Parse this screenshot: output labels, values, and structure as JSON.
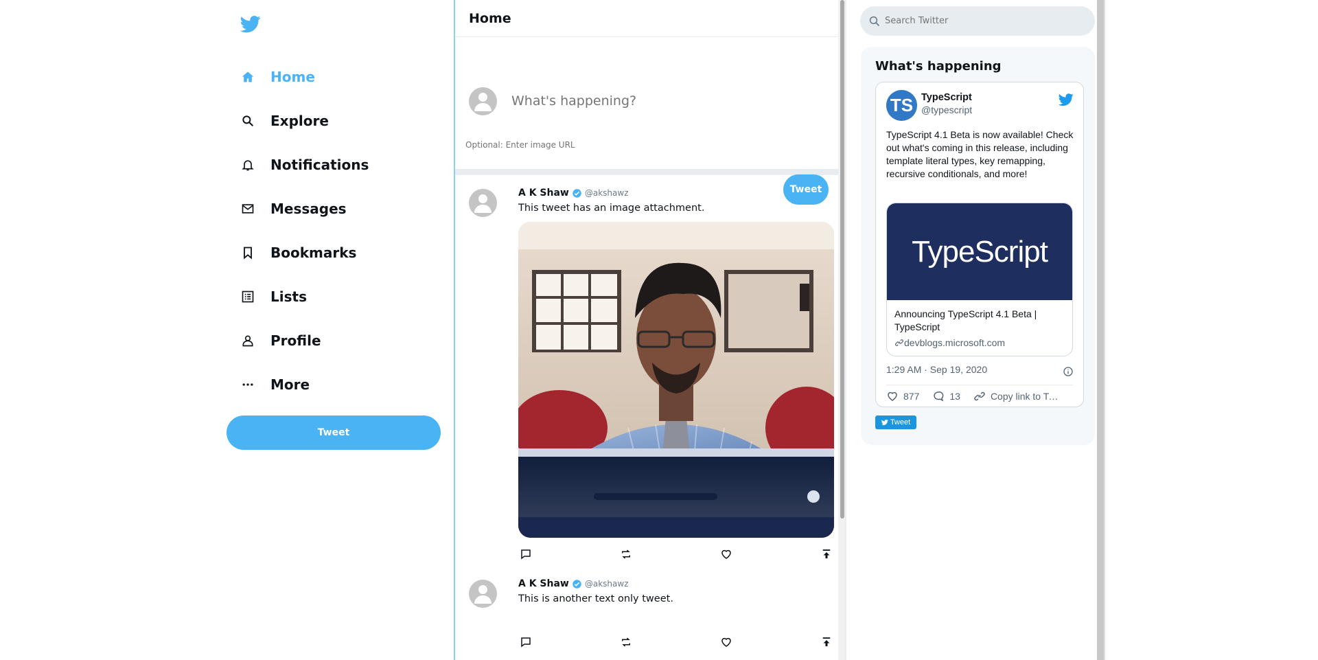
{
  "colors": {
    "accent": "#4ab3f4",
    "feed_border": "#8ecdf5",
    "typescript_blue": "#3178c6",
    "card_navy": "#1e2e5f"
  },
  "sidebar": {
    "logo_icon": "twitter-bird-icon",
    "items": [
      {
        "label": "Home",
        "icon": "home-icon",
        "active": true
      },
      {
        "label": "Explore",
        "icon": "search-icon"
      },
      {
        "label": "Notifications",
        "icon": "bell-icon"
      },
      {
        "label": "Messages",
        "icon": "mail-icon"
      },
      {
        "label": "Bookmarks",
        "icon": "bookmark-icon"
      },
      {
        "label": "Lists",
        "icon": "list-icon"
      },
      {
        "label": "Profile",
        "icon": "person-icon"
      },
      {
        "label": "More",
        "icon": "more-icon"
      }
    ],
    "tweet_button": "Tweet"
  },
  "feed": {
    "title": "Home",
    "composer": {
      "placeholder": "What's happening?",
      "image_placeholder": "Optional: Enter image URL",
      "tweet_button": "Tweet"
    },
    "tweets": [
      {
        "name": "A K Shaw",
        "handle": "@akshawz",
        "verified": true,
        "text": "This tweet has an image attachment.",
        "has_image": true
      },
      {
        "name": "A K Shaw",
        "handle": "@akshawz",
        "verified": true,
        "text": "This is another text only tweet.",
        "has_image": false
      }
    ]
  },
  "right": {
    "search_placeholder": "Search Twitter",
    "panel_title": "What's happening",
    "embed": {
      "avatar_text": "TS",
      "name": "TypeScript",
      "handle": "@typescript",
      "text": "TypeScript 4.1 Beta is now available! Check out what's coming in this release, including template literal types, key remapping, recursive conditionals, and more!",
      "card_image_text": "TypeScript",
      "card_title": "Announcing TypeScript 4.1 Beta | TypeScript",
      "card_domain": "devblogs.microsoft.com",
      "timestamp": "1:29 AM · Sep 19, 2020",
      "likes": "877",
      "replies": "13",
      "copy_link": "Copy link to Tweet"
    },
    "embed_tweet_button": "Tweet"
  }
}
